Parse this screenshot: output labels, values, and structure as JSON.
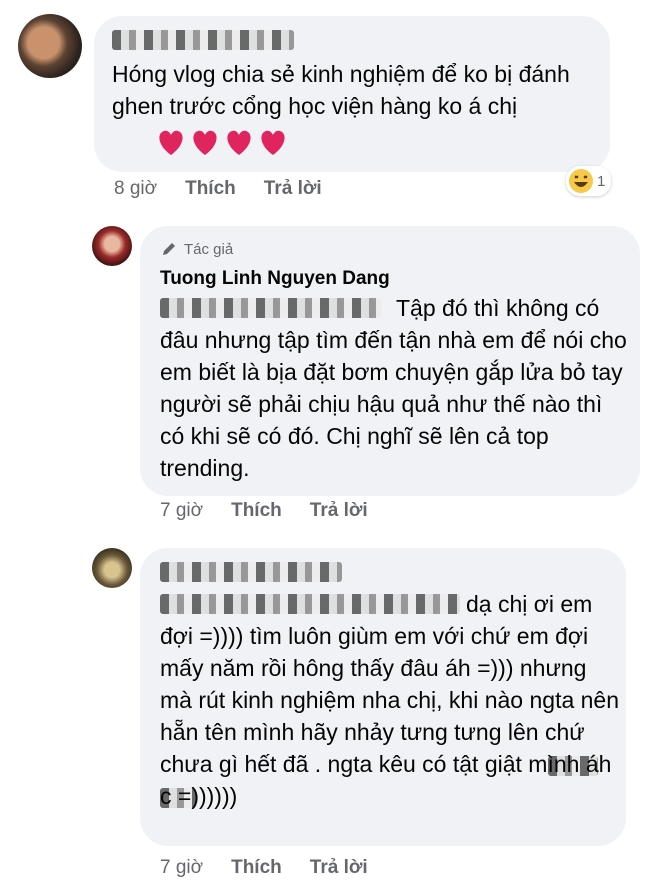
{
  "comment1": {
    "text": "Hóng vlog chia sẻ kinh nghiệm để ko bị đánh ghen trước cổng học viện hàng ko á chị",
    "time": "8 giờ",
    "like_label": "Thích",
    "reply_label": "Trả lời",
    "reaction_count": "1",
    "reaction_icon": "laughing-emoji-icon",
    "heart_icon": "red-heart-icon",
    "heart_color": "#e0245e"
  },
  "reply1": {
    "author_tag": "Tác giả",
    "author_name": "Tuong Linh Nguyen Dang",
    "mention": "Linh Mắt Biếc",
    "text": "Tập đó thì không có đâu nhưng tập tìm đến tận nhà em để nói cho em biết là bịa đặt bơm chuyện gắp lửa bỏ tay người sẽ phải chịu hậu quả như thế nào thì có khi sẽ có đó. Chị nghĩ sẽ lên cả top trending.",
    "time": "7 giờ",
    "like_label": "Thích",
    "reply_label": "Trả lời"
  },
  "reply2": {
    "text": "dạ chị ơi em đợi =)))) tìm luôn giùm em với chứ em đợi mấy năm rồi hông thấy đâu áh =))) nhưng mà rút kinh nghiệm nha chị, khi nào ngta nên hẵn tên mình hãy nhảy tưng tưng lên chứ chưa gì hết đã . ngta kêu có tật giật mình áh c =))))))",
    "time": "7 giờ",
    "like_label": "Thích",
    "reply_label": "Trả lời"
  },
  "colors": {
    "bubble": "#f0f2f5",
    "meta_text": "#65676b",
    "text": "#050505"
  }
}
